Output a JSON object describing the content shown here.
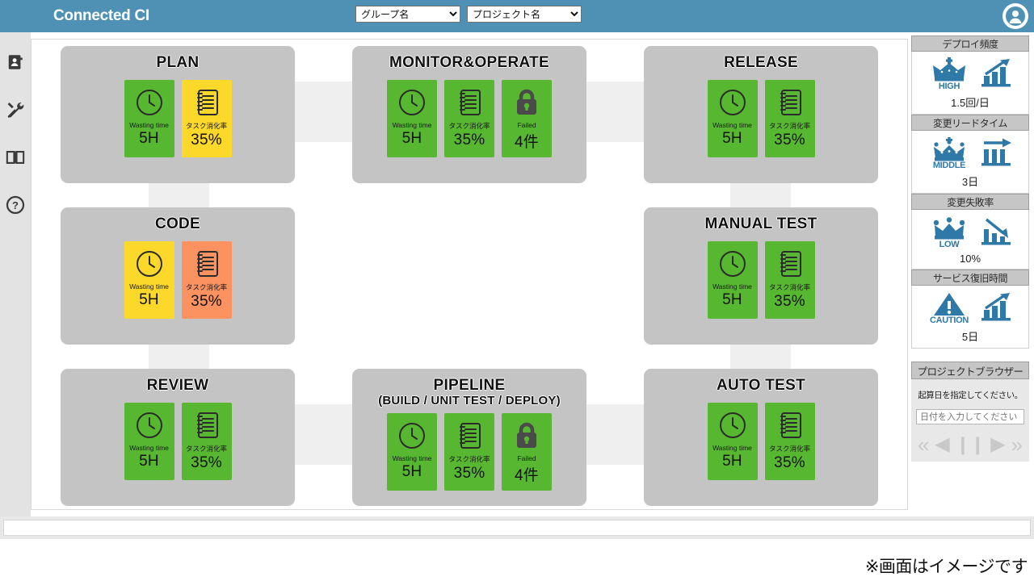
{
  "header": {
    "brand": "Connected CI",
    "group_select": {
      "name": "group-select",
      "value": "グループ名",
      "options": [
        "グループ名"
      ]
    },
    "project_select": {
      "name": "project-select",
      "value": "プロジェクト名",
      "options": [
        "プロジェクト名"
      ]
    },
    "avatar_icon": "user-avatar-icon",
    "bg_color": "#4e91b5"
  },
  "rail": {
    "items": [
      {
        "icon": "contact-card-icon",
        "label": ""
      },
      {
        "icon": "tools-icon",
        "label": ""
      },
      {
        "icon": "book-icon",
        "label": ""
      },
      {
        "icon": "help-circle-icon",
        "label": ""
      }
    ]
  },
  "tile_labels": {
    "wasting_time": "Wasting time",
    "task_rate": "タスク消化率",
    "failed": "Failed"
  },
  "colors": {
    "green": "#57b731",
    "yellow": "#fcd82a",
    "orange": "#fb9260",
    "panel": "#c4c4c4",
    "accent": "#4e91b5",
    "metric_blue": "#2f79a8"
  },
  "panels": [
    {
      "id": "plan",
      "title": "PLAN",
      "subtitle": "",
      "tiles": [
        {
          "icon": "clock-icon",
          "label": "Wasting time",
          "value": "5H",
          "color": "green"
        },
        {
          "icon": "notebook-icon",
          "label": "タスク消化率",
          "value": "35%",
          "color": "yellow"
        }
      ]
    },
    {
      "id": "monitor-operate",
      "title": "MONITOR&OPERATE",
      "subtitle": "",
      "tiles": [
        {
          "icon": "clock-icon",
          "label": "Wasting time",
          "value": "5H",
          "color": "green"
        },
        {
          "icon": "notebook-icon",
          "label": "タスク消化率",
          "value": "35%",
          "color": "green"
        },
        {
          "icon": "lock-icon",
          "label": "Failed",
          "value": "4件",
          "color": "green"
        }
      ]
    },
    {
      "id": "release",
      "title": "RELEASE",
      "subtitle": "",
      "tiles": [
        {
          "icon": "clock-icon",
          "label": "Wasting time",
          "value": "5H",
          "color": "green"
        },
        {
          "icon": "notebook-icon",
          "label": "タスク消化率",
          "value": "35%",
          "color": "green"
        }
      ]
    },
    {
      "id": "code",
      "title": "CODE",
      "subtitle": "",
      "tiles": [
        {
          "icon": "clock-icon",
          "label": "Wasting time",
          "value": "5H",
          "color": "yellow"
        },
        {
          "icon": "notebook-icon",
          "label": "タスク消化率",
          "value": "35%",
          "color": "orange"
        }
      ]
    },
    {
      "id": "manual-test",
      "title": "MANUAL TEST",
      "subtitle": "",
      "tiles": [
        {
          "icon": "clock-icon",
          "label": "Wasting time",
          "value": "5H",
          "color": "green"
        },
        {
          "icon": "notebook-icon",
          "label": "タスク消化率",
          "value": "35%",
          "color": "green"
        }
      ]
    },
    {
      "id": "review",
      "title": "REVIEW",
      "subtitle": "",
      "tiles": [
        {
          "icon": "clock-icon",
          "label": "Wasting time",
          "value": "5H",
          "color": "green"
        },
        {
          "icon": "notebook-icon",
          "label": "タスク消化率",
          "value": "35%",
          "color": "green"
        }
      ]
    },
    {
      "id": "pipeline",
      "title": "PIPELINE",
      "subtitle": "(BUILD / UNIT TEST / DEPLOY)",
      "tiles": [
        {
          "icon": "clock-icon",
          "label": "Wasting time",
          "value": "5H",
          "color": "green"
        },
        {
          "icon": "notebook-icon",
          "label": "タスク消化率",
          "value": "35%",
          "color": "green"
        },
        {
          "icon": "lock-icon",
          "label": "Failed",
          "value": "4件",
          "color": "green"
        }
      ]
    },
    {
      "id": "auto-test",
      "title": "AUTO TEST",
      "subtitle": "",
      "tiles": [
        {
          "icon": "clock-icon",
          "label": "Wasting time",
          "value": "5H",
          "color": "green"
        },
        {
          "icon": "notebook-icon",
          "label": "タスク消化率",
          "value": "35%",
          "color": "green"
        }
      ]
    }
  ],
  "metrics": [
    {
      "id": "deploy-frequency",
      "title": "デプロイ頻度",
      "rank": "HIGH",
      "rank_icon": "crown-high-icon",
      "trend_icon": "chart-up-icon",
      "value": "1.5回/日"
    },
    {
      "id": "lead-time",
      "title": "変更リードタイム",
      "rank": "MIDDLE",
      "rank_icon": "crown-middle-icon",
      "trend_icon": "chart-flat-icon",
      "value": "3日"
    },
    {
      "id": "change-failure-rate",
      "title": "変更失敗率",
      "rank": "LOW",
      "rank_icon": "crown-low-icon",
      "trend_icon": "chart-down-icon",
      "value": "10%"
    },
    {
      "id": "service-restore-time",
      "title": "サービス復旧時間",
      "rank": "CAUTION",
      "rank_icon": "warning-triangle-icon",
      "trend_icon": "chart-up-icon",
      "value": "5日"
    }
  ],
  "project_browser": {
    "title": "プロジェクトブラウザー",
    "note": "起算日を指定してください。",
    "date_input": {
      "value": "",
      "placeholder": "日付を入力してください"
    },
    "controls": [
      {
        "name": "rewind-button",
        "glyph": "«"
      },
      {
        "name": "step-back-button",
        "glyph": "◀"
      },
      {
        "name": "pause-button",
        "glyph": "❙❙"
      },
      {
        "name": "play-button",
        "glyph": "▶"
      },
      {
        "name": "fast-forward-button",
        "glyph": "»"
      }
    ]
  },
  "caption": "※画面はイメージです"
}
